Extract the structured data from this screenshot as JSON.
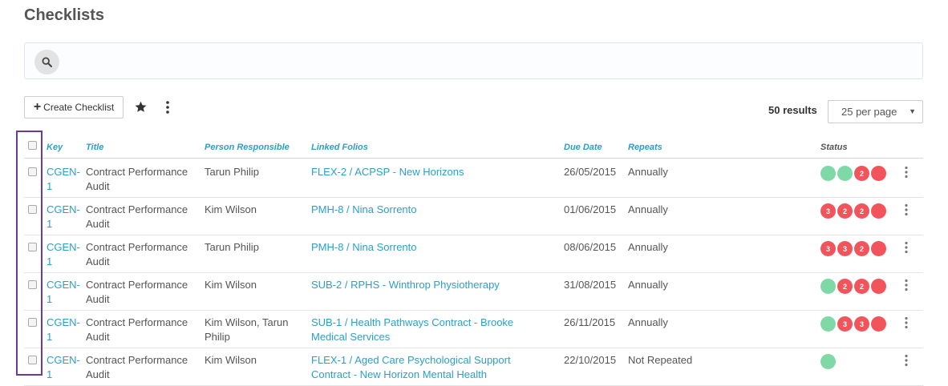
{
  "page": {
    "title": "Checklists"
  },
  "search": {
    "placeholder": ""
  },
  "toolbar": {
    "create_label": "Create Checklist",
    "results_label": "50 results",
    "per_page": "25 per page"
  },
  "table": {
    "headers": {
      "key": "Key",
      "title": "Title",
      "person": "Person Responsible",
      "folios": "Linked Folios",
      "due": "Due Date",
      "repeats": "Repeats",
      "status": "Status"
    },
    "rows": [
      {
        "key": "CGEN-1",
        "title": "Contract Performance Audit",
        "person": "Tarun Philip",
        "folio": "FLEX-2 / ACPSP - New Horizons",
        "due": "26/05/2015",
        "repeats": "Annually",
        "status": [
          {
            "c": "green",
            "n": ""
          },
          {
            "c": "green",
            "n": ""
          },
          {
            "c": "red",
            "n": "2"
          },
          {
            "c": "red",
            "n": ""
          }
        ]
      },
      {
        "key": "CGEN-1",
        "title": "Contract Performance Audit",
        "person": "Kim Wilson",
        "folio": "PMH-8 / Nina Sorrento",
        "due": "01/06/2015",
        "repeats": "Annually",
        "status": [
          {
            "c": "red",
            "n": "3"
          },
          {
            "c": "red",
            "n": "2"
          },
          {
            "c": "red",
            "n": "2"
          },
          {
            "c": "red",
            "n": ""
          }
        ]
      },
      {
        "key": "CGEN-1",
        "title": "Contract Performance Audit",
        "person": "Tarun Philip",
        "folio": "PMH-8 / Nina Sorrento",
        "due": "08/06/2015",
        "repeats": "Annually",
        "status": [
          {
            "c": "red",
            "n": "3"
          },
          {
            "c": "red",
            "n": "3"
          },
          {
            "c": "red",
            "n": "2"
          },
          {
            "c": "red",
            "n": ""
          }
        ]
      },
      {
        "key": "CGEN-1",
        "title": "Contract Performance Audit",
        "person": "Kim Wilson",
        "folio": "SUB-2 / RPHS - Winthrop Physiotherapy",
        "due": "31/08/2015",
        "repeats": "Annually",
        "status": [
          {
            "c": "green",
            "n": ""
          },
          {
            "c": "red",
            "n": "2"
          },
          {
            "c": "red",
            "n": "2"
          },
          {
            "c": "red",
            "n": ""
          }
        ]
      },
      {
        "key": "CGEN-1",
        "title": "Contract Performance Audit",
        "person": "Kim Wilson, Tarun Philip",
        "folio": "SUB-1 / Health Pathways Contract - Brooke Medical Services",
        "due": "26/11/2015",
        "repeats": "Annually",
        "status": [
          {
            "c": "green",
            "n": ""
          },
          {
            "c": "red",
            "n": "3"
          },
          {
            "c": "red",
            "n": "3"
          },
          {
            "c": "red",
            "n": ""
          }
        ]
      },
      {
        "key": "CGEN-1",
        "title": "Contract Performance Audit",
        "person": "Kim Wilson",
        "folio": "FLEX-1 / Aged Care Psychological Support Contract - New Horizon Mental Health",
        "due": "22/10/2015",
        "repeats": "Not Repeated",
        "status": [
          {
            "c": "green",
            "n": ""
          }
        ]
      }
    ]
  },
  "colors": {
    "accent": "#2aa0c8",
    "green": "#7fd9a6",
    "red": "#f2545b",
    "highlight": "#6a3a9c"
  },
  "icons": {
    "search": "search-icon",
    "star": "star-icon",
    "more": "more-vertical-icon"
  }
}
